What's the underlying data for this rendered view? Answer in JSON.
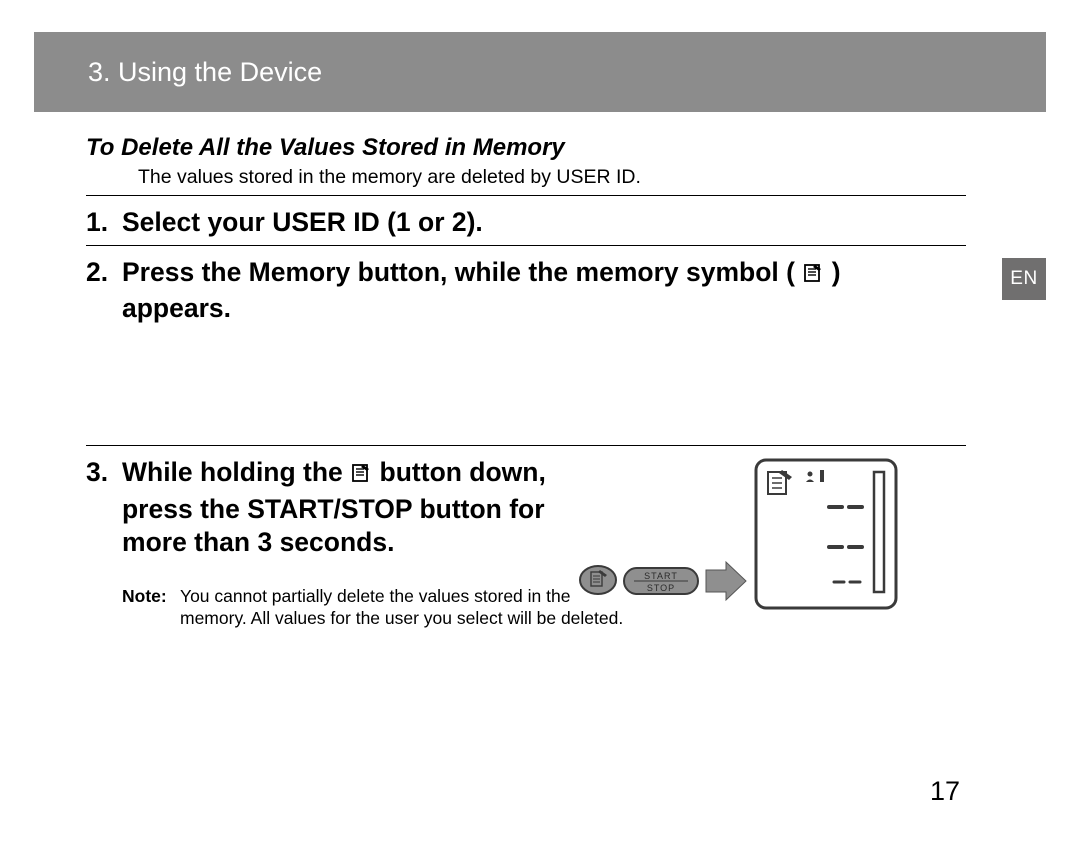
{
  "header": {
    "chapter": "3. Using the Device"
  },
  "lang_tab": "EN",
  "page_number": "17",
  "section": {
    "title": "To Delete All the Values Stored in Memory",
    "intro": "The values stored in the memory are deleted by USER ID.",
    "steps": {
      "s1_num": "1.",
      "s1_text": "Select your USER ID (1 or 2).",
      "s2_num": "2.",
      "s2_text_a": "Press the Memory button, while the memory symbol (",
      "s2_text_b": ") appears.",
      "s3_num": "3.",
      "s3_text_a": "While holding the ",
      "s3_text_b": " button down, press the START/STOP button for more than 3 seconds."
    },
    "note_label": "Note:",
    "note_text": "You cannot partially delete the values stored in the memory. All values for the user you select will be deleted.",
    "figure": {
      "start_label": "START",
      "stop_label": "STOP"
    }
  }
}
